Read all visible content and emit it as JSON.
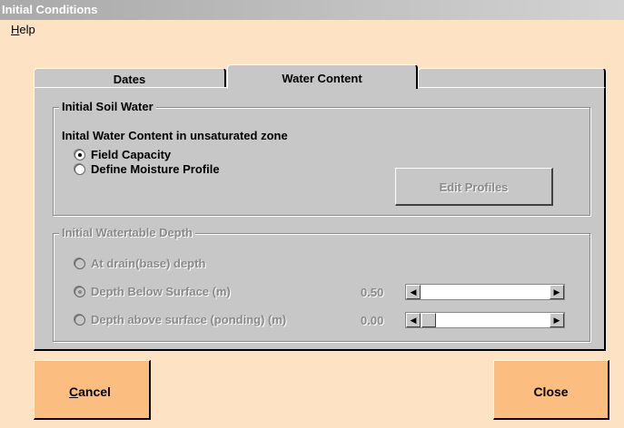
{
  "window": {
    "title": "Initial Conditions"
  },
  "menu": {
    "help_label": "Help",
    "help_mnemonic": "H",
    "help_rest": "elp"
  },
  "tabs": [
    {
      "label": "Dates",
      "selected": false
    },
    {
      "label": "Water Content",
      "selected": true
    }
  ],
  "initial_soil_water": {
    "legend": "Initial Soil Water",
    "heading": "Inital Water Content in unsaturated zone",
    "options": [
      {
        "label": "Field Capacity",
        "selected": true
      },
      {
        "label": "Define Moisture Profile",
        "selected": false
      }
    ],
    "edit_profiles_label": "Edit Profiles"
  },
  "watertable": {
    "legend": "Initial Watertable Depth",
    "options": [
      {
        "label": "At drain(base) depth",
        "selected": false
      },
      {
        "label": "Depth Below Surface (m)",
        "selected": true,
        "value": "0.50",
        "slider_fraction": 0.0
      },
      {
        "label": "Depth above surface (ponding) (m)",
        "selected": false,
        "value": "0.00",
        "slider_fraction": 0.0
      }
    ]
  },
  "buttons": {
    "cancel_label": "Cancel",
    "cancel_mnemonic": "C",
    "cancel_rest": "ancel",
    "close_label": "Close"
  },
  "colors": {
    "background": "#fde2c4",
    "panel": "#c7c7c7",
    "action_button": "#fcbd80",
    "disabled_text": "#8a8a8a"
  }
}
